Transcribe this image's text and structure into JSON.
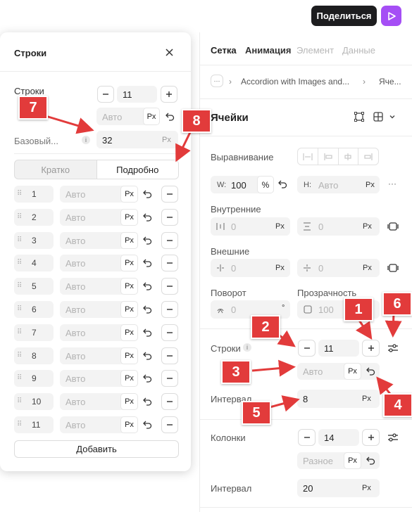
{
  "topbar": {
    "share_label": "Поделиться"
  },
  "right": {
    "tabs": [
      "Сетка",
      "Анимация",
      "Элемент",
      "Данные"
    ],
    "breadcrumb": {
      "more": "···",
      "item1": "Accordion with Images and...",
      "item2": "Яче..."
    },
    "section_title": "Ячейки",
    "align_label": "Выравнивание",
    "w": {
      "prefix": "W:",
      "value": "100",
      "unit": "%"
    },
    "h": {
      "prefix": "H:",
      "placeholder": "Авто",
      "unit": "Px"
    },
    "more_dots": "···",
    "padding_label": "Внутренние",
    "padding_left": {
      "value": "0",
      "unit": "Px"
    },
    "padding_right": {
      "value": "0",
      "unit": "Px"
    },
    "margin_label": "Внешние",
    "margin_left": {
      "value": "0",
      "unit": "Px"
    },
    "margin_right": {
      "value": "0",
      "unit": "Px"
    },
    "rotation_label": "Поворот",
    "rotation": {
      "value": "0",
      "unit": "°"
    },
    "opacity_label": "Прозрачность",
    "opacity": {
      "value": "100"
    },
    "rows_label": "Строки",
    "rows_info": "i",
    "rows_value": "11",
    "rows_auto": "Авто",
    "rows_unit": "Px",
    "row_gap_label": "Интервал",
    "row_gap": {
      "value": "8",
      "unit": "Px"
    },
    "cols_label": "Колонки",
    "cols_value": "14",
    "cols_mode": "Разное",
    "cols_unit": "Px",
    "col_gap_label": "Интервал",
    "col_gap": {
      "value": "20",
      "unit": "Px"
    }
  },
  "left": {
    "title": "Строки",
    "rows_label": "Строки",
    "rows_value": "11",
    "auto_placeholder": "Авто",
    "unit": "Px",
    "base_label": "Базовый...",
    "base_info": "i",
    "base_value": "32",
    "seg_short": "Кратко",
    "seg_detail": "Подробно",
    "rows": [
      "1",
      "2",
      "3",
      "4",
      "5",
      "6",
      "7",
      "8",
      "9",
      "10",
      "11"
    ],
    "row_placeholder": "Авто",
    "add_label": "Добавить"
  },
  "annotations": [
    "1",
    "2",
    "3",
    "4",
    "5",
    "6",
    "7",
    "8"
  ],
  "colors": {
    "accent_red": "#e23b3b",
    "play_purple": "#a54ef5",
    "share_black": "#1d1d1f"
  }
}
